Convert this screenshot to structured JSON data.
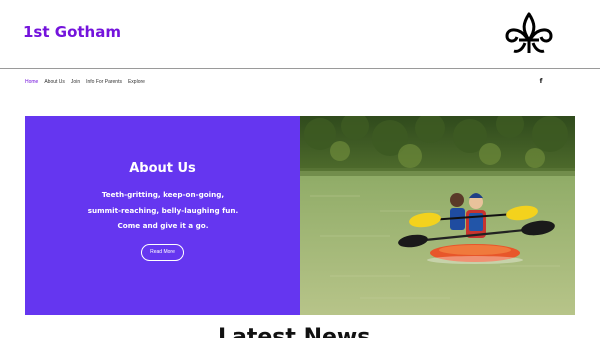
{
  "header": {
    "site_title": "1st Gotham",
    "logo_icon": "fleur-de-lis-icon"
  },
  "nav": {
    "items": [
      {
        "label": "Home",
        "active": true
      },
      {
        "label": "About Us",
        "active": false
      },
      {
        "label": "Join",
        "active": false
      },
      {
        "label": "Info For Parents",
        "active": false
      },
      {
        "label": "Explore",
        "active": false
      }
    ],
    "social_icon": "facebook-icon",
    "social_glyph": "f"
  },
  "hero": {
    "heading": "About Us",
    "text": "Teeth-gritting, keep-on-going, summit-reaching, belly-laughing fun. Come and give it a go.",
    "button_label": "Read More",
    "photo": "children-kayaking-photo"
  },
  "latest": {
    "heading": "Latest News"
  },
  "colors": {
    "brand_purple": "#7413dc",
    "panel_purple": "#6536f0"
  }
}
